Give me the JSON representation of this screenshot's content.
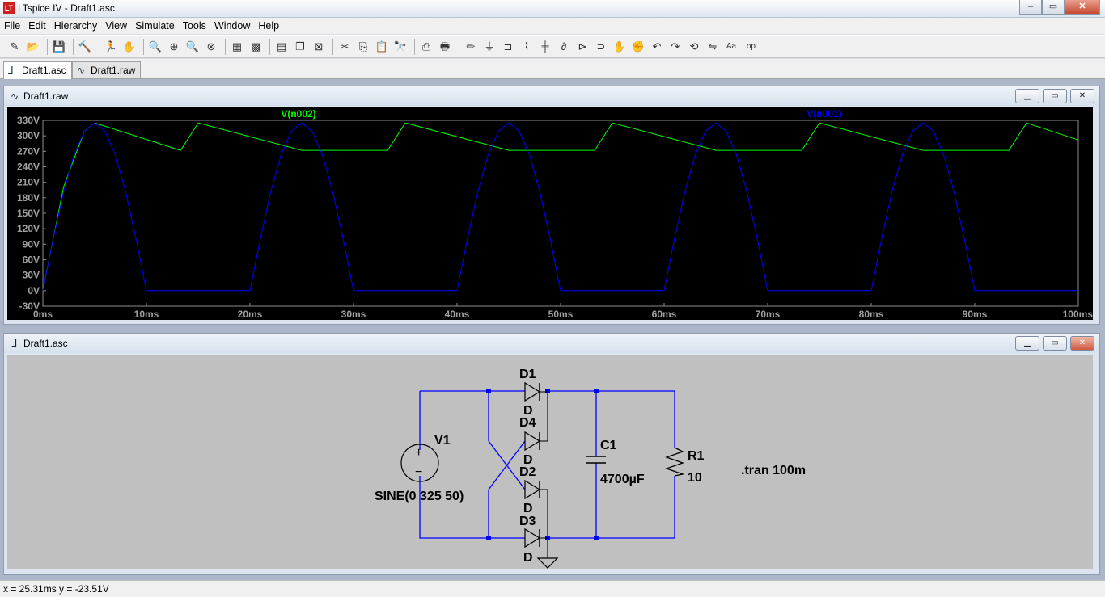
{
  "window": {
    "title": "LTspice IV - Draft1.asc",
    "minimize": "–",
    "maximize": "▭",
    "close": "✕"
  },
  "menu": [
    "File",
    "Edit",
    "Hierarchy",
    "View",
    "Simulate",
    "Tools",
    "Window",
    "Help"
  ],
  "toolbar": {
    "groups": [
      [
        "new-schematic-icon",
        "open-icon"
      ],
      [
        "save-icon"
      ],
      [
        "control-panel-icon"
      ],
      [
        "run-icon",
        "halt-icon"
      ],
      [
        "zoom-in-icon",
        "pan-icon",
        "zoom-out-icon",
        "zoom-cancel-icon"
      ],
      [
        "autorange-icon",
        "grid-icon"
      ],
      [
        "tile-horizontal-icon",
        "cascade-icon",
        "close-all-icon"
      ],
      [
        "cut-icon",
        "copy-icon",
        "paste-icon",
        "find-icon"
      ],
      [
        "print-setup-icon",
        "print-icon"
      ],
      [
        "wire-icon",
        "ground-icon",
        "label-net-icon",
        "resistor-icon",
        "capacitor-icon",
        "inductor-icon",
        "diode-icon",
        "component-icon",
        "move-icon",
        "drag-icon",
        "undo-icon",
        "redo-icon",
        "rotate-icon",
        "mirror-icon",
        "text-icon",
        "spice-directive-icon"
      ]
    ],
    "glyphs": {
      "new-schematic-icon": "✎",
      "open-icon": "📂",
      "save-icon": "💾",
      "control-panel-icon": "🔨",
      "run-icon": "🏃",
      "halt-icon": "✋",
      "zoom-in-icon": "🔍",
      "pan-icon": "⊕",
      "zoom-out-icon": "🔍",
      "zoom-cancel-icon": "⊗",
      "autorange-icon": "▦",
      "grid-icon": "▩",
      "tile-horizontal-icon": "▤",
      "cascade-icon": "❐",
      "close-all-icon": "⊠",
      "cut-icon": "✂",
      "copy-icon": "⎘",
      "paste-icon": "📋",
      "find-icon": "🔭",
      "print-setup-icon": "⎙",
      "print-icon": "🖶",
      "wire-icon": "✏",
      "ground-icon": "⏚",
      "label-net-icon": "⊐",
      "resistor-icon": "⌇",
      "capacitor-icon": "╪",
      "inductor-icon": "∂",
      "diode-icon": "⊳",
      "component-icon": "⊃",
      "move-icon": "✋",
      "drag-icon": "✊",
      "undo-icon": "↶",
      "redo-icon": "↷",
      "rotate-icon": "⟲",
      "mirror-icon": "⇋",
      "text-icon": "Aa",
      "spice-directive-icon": ".op"
    }
  },
  "tabs": [
    {
      "label": "Draft1.asc",
      "icon": "schematic-icon"
    },
    {
      "label": "Draft1.raw",
      "icon": "waveform-icon"
    }
  ],
  "waveform_window": {
    "title": "Draft1.raw"
  },
  "schematic_window": {
    "title": "Draft1.asc"
  },
  "chart_data": {
    "type": "line",
    "xlabel": "",
    "ylabel": "",
    "xlim": [
      0,
      100
    ],
    "ylim": [
      -30,
      330
    ],
    "x_tick_labels": [
      "0ms",
      "10ms",
      "20ms",
      "30ms",
      "40ms",
      "50ms",
      "60ms",
      "70ms",
      "80ms",
      "90ms",
      "100ms"
    ],
    "y_tick_labels": [
      "330V",
      "300V",
      "270V",
      "240V",
      "210V",
      "180V",
      "150V",
      "120V",
      "90V",
      "60V",
      "30V",
      "0V",
      "-30V"
    ],
    "series": [
      {
        "name": "V(n002)",
        "color": "#00ff00",
        "x": [
          0,
          2,
          4,
          5,
          13.3,
          15,
          25,
          33.3,
          35,
          45,
          53.3,
          55,
          65,
          73.3,
          75,
          85,
          93.3,
          95,
          100
        ],
        "y": [
          0,
          201,
          309,
          325,
          272,
          325,
          272,
          272,
          325,
          272,
          272,
          325,
          272,
          272,
          325,
          272,
          272,
          325,
          292
        ]
      },
      {
        "name": "V(n001)",
        "color": "#0000ff",
        "x": [
          0,
          1,
          2,
          3,
          4,
          5,
          6,
          7,
          8,
          9,
          10,
          11,
          12,
          13,
          14,
          15,
          16,
          17,
          18,
          19,
          20,
          21,
          22,
          23,
          24,
          25,
          26,
          27,
          28,
          29,
          30,
          31,
          32,
          33,
          34,
          35,
          36,
          37,
          38,
          39,
          40,
          41,
          42,
          43,
          44,
          45,
          46,
          47,
          48,
          49,
          50,
          51,
          52,
          53,
          54,
          55,
          56,
          57,
          58,
          59,
          60,
          61,
          62,
          63,
          64,
          65,
          66,
          67,
          68,
          69,
          70,
          71,
          72,
          73,
          74,
          75,
          76,
          77,
          78,
          79,
          80,
          81,
          82,
          83,
          84,
          85,
          86,
          87,
          88,
          89,
          90,
          91,
          92,
          93,
          94,
          95,
          96,
          97,
          98,
          99,
          100
        ],
        "y": [
          0,
          100,
          191,
          263,
          309,
          325,
          309,
          263,
          191,
          100,
          0,
          0,
          0,
          0,
          0,
          0,
          0,
          0,
          0,
          0,
          0,
          100,
          191,
          263,
          309,
          325,
          309,
          263,
          191,
          100,
          0,
          0,
          0,
          0,
          0,
          0,
          0,
          0,
          0,
          0,
          0,
          100,
          191,
          263,
          309,
          325,
          309,
          263,
          191,
          100,
          0,
          0,
          0,
          0,
          0,
          0,
          0,
          0,
          0,
          0,
          0,
          100,
          191,
          263,
          309,
          325,
          309,
          263,
          191,
          100,
          0,
          0,
          0,
          0,
          0,
          0,
          0,
          0,
          0,
          0,
          0,
          100,
          191,
          263,
          309,
          325,
          309,
          263,
          191,
          100,
          0,
          0,
          0,
          0,
          0,
          0,
          0,
          0,
          0,
          0,
          0
        ]
      }
    ]
  },
  "schematic": {
    "v1": {
      "name": "V1",
      "value": "SINE(0 325 50)"
    },
    "d1": {
      "name": "D1",
      "model": "D"
    },
    "d4": {
      "name": "D4",
      "model": "D"
    },
    "d2": {
      "name": "D2",
      "model": "D"
    },
    "d3": {
      "name": "D3",
      "model": "D"
    },
    "c1": {
      "name": "C1",
      "value": "4700µF"
    },
    "r1": {
      "name": "R1",
      "value": "10"
    },
    "directive": ".tran 100m"
  },
  "status": {
    "text": "x = 25.31ms    y = -23.51V"
  }
}
